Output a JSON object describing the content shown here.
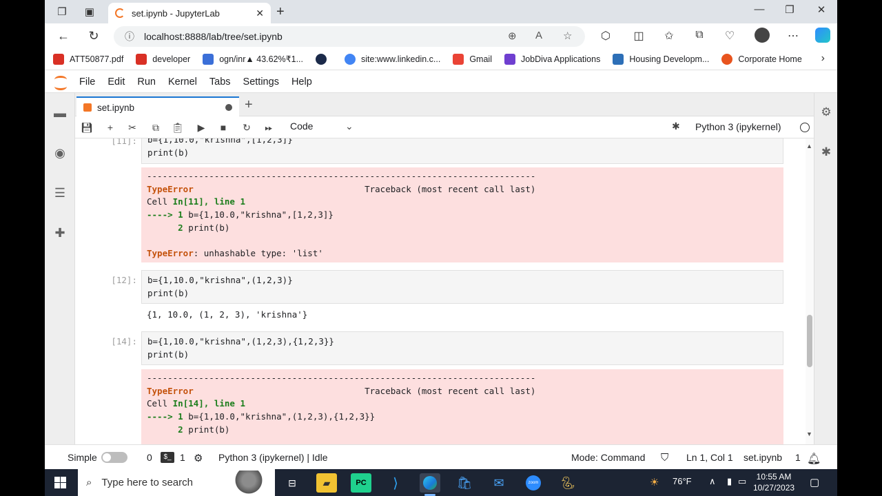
{
  "browser": {
    "tab_title": "set.ipynb - JupyterLab",
    "url": "localhost:8888/lab/tree/set.ipynb",
    "bookmarks": [
      {
        "label": "ATT50877.pdf",
        "color": "#d93025"
      },
      {
        "label": "developer",
        "color": "#d93025"
      },
      {
        "label": "ogn/inr▲ 43.62%₹1...",
        "color": "#3b6fd8"
      },
      {
        "label": "",
        "color": "#1b2a4a"
      },
      {
        "label": "site:www.linkedin.c...",
        "color": "#4285f4"
      },
      {
        "label": "Gmail",
        "color": "#ea4335"
      },
      {
        "label": "JobDiva Applications",
        "color": "#6f3fd0"
      },
      {
        "label": "Housing Developm...",
        "color": "#2d6fb7"
      },
      {
        "label": "Corporate Home",
        "color": "#e8541e"
      }
    ]
  },
  "jupyter": {
    "menu": [
      "File",
      "Edit",
      "Run",
      "Kernel",
      "Tabs",
      "Settings",
      "Help"
    ],
    "doc_tab": "set.ipynb",
    "cell_type": "Code",
    "kernel_name": "Python 3 (ipykernel)"
  },
  "cells": {
    "c11": {
      "prompt": "[11]:",
      "line1_fragment": "b={1,10.0,\"krishna\",[1,2,3]}",
      "line2": "print(b)",
      "err_sep": "---------------------------------------------------------------------------",
      "err_name": "TypeError",
      "err_tb": "Traceback (most recent call last)",
      "cell_word": "Cell ",
      "cell_ref": "In[11], line 1",
      "arrow": "----> 1 ",
      "arrow_code": "b={1,10.0,\"krishna\",[1,2,3]}",
      "line_2": "      2 ",
      "line_2_code": "print(b)",
      "err_msg_name": "TypeError",
      "err_msg": ": unhashable type: 'list'"
    },
    "c12": {
      "prompt": "[12]:",
      "line1": "b={1,10.0,\"krishna\",(1,2,3)}",
      "line2": "print(b)",
      "output": "{1, 10.0, (1, 2, 3), 'krishna'}"
    },
    "c14": {
      "prompt": "[14]:",
      "line1": "b={1,10.0,\"krishna\",(1,2,3),{1,2,3}}",
      "line2": "print(b)",
      "err_sep": "---------------------------------------------------------------------------",
      "err_name": "TypeError",
      "err_tb": "Traceback (most recent call last)",
      "cell_word": "Cell ",
      "cell_ref": "In[14], line 1",
      "arrow": "----> 1 ",
      "arrow_code": "b={1,10.0,\"krishna\",(1,2,3),{1,2,3}}",
      "line_2": "      2 ",
      "line_2_code": "print(b)"
    }
  },
  "statusbar": {
    "mode_label": "Simple",
    "count_0": "0",
    "term_label": "$_",
    "count_1": "1",
    "kernel_status": "Python 3 (ipykernel) | Idle",
    "mode": "Mode: Command",
    "position": "Ln 1, Col 1",
    "file": "set.ipynb",
    "notifications": "1"
  },
  "taskbar": {
    "search_placeholder": "Type here to search",
    "weather": "76°F",
    "time": "10:55 AM",
    "date": "10/27/2023"
  }
}
